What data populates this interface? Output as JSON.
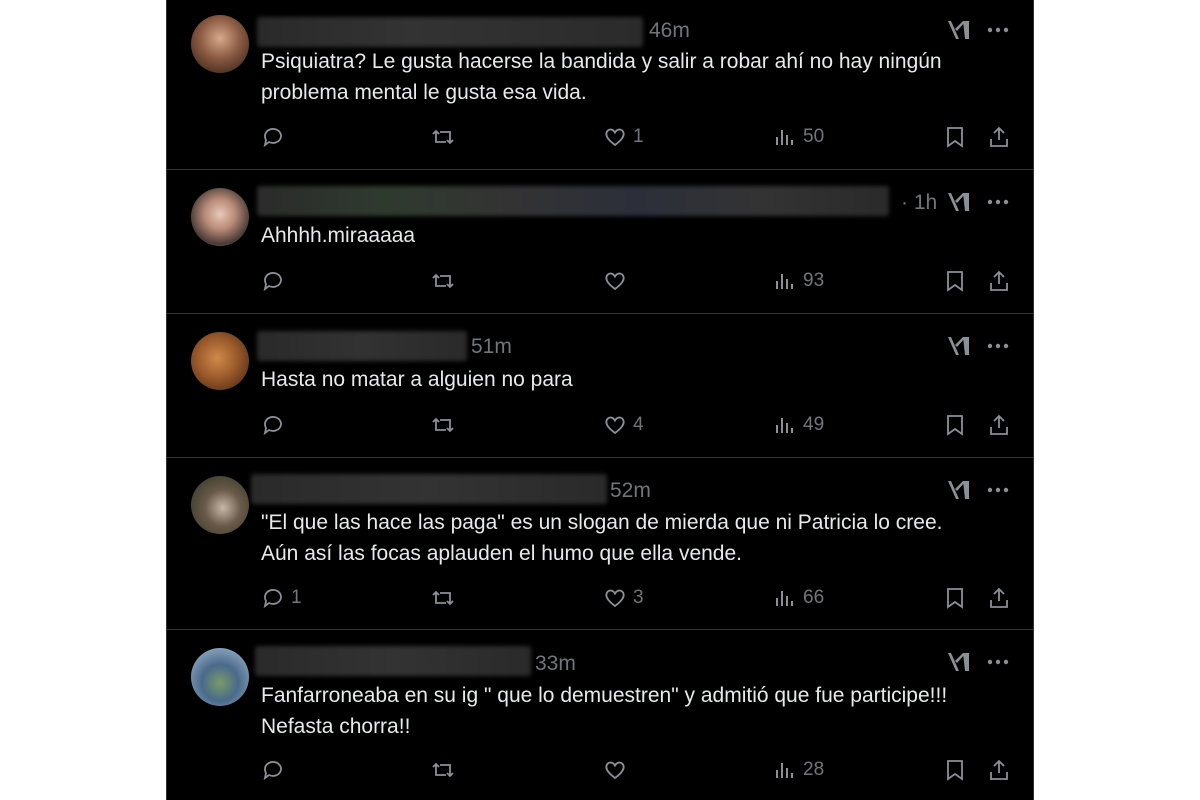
{
  "tweets": [
    {
      "time": "46m",
      "text": "Psiquiatra? Le gusta hacerse la bandida y salir a robar ahí no hay ningún\nproblema mental le gusta esa vida.",
      "replies": "",
      "retweets": "",
      "likes": "1",
      "views": "50"
    },
    {
      "time": "· 1h",
      "text": "Ahhhh.miraaaaa",
      "replies": "",
      "retweets": "",
      "likes": "",
      "views": "93"
    },
    {
      "time": "51m",
      "text": "Hasta no matar a alguien no para",
      "replies": "",
      "retweets": "",
      "likes": "4",
      "views": "49"
    },
    {
      "time": "52m",
      "text": "\"El que las hace las paga\" es un slogan de mierda que ni Patricia lo cree.\nAún así las focas aplauden el humo que ella vende.",
      "replies": "1",
      "retweets": "",
      "likes": "3",
      "views": "66"
    },
    {
      "time": "33m",
      "text": "Fanfarroneaba en su ig \" que lo demuestren\" y admitió que fue participe!!!\nNefasta chorra!!",
      "replies": "",
      "retweets": "",
      "likes": "",
      "views": "28"
    }
  ],
  "icons": {
    "reply": "reply-icon",
    "retweet": "retweet-icon",
    "like": "heart-icon",
    "views": "views-icon",
    "bookmark": "bookmark-icon",
    "share": "share-icon",
    "grok": "grok-icon",
    "more": "more-icon"
  },
  "colors": {
    "background": "#000000",
    "text": "#e7e9ea",
    "secondary": "#71767b",
    "divider": "#2f3336"
  }
}
